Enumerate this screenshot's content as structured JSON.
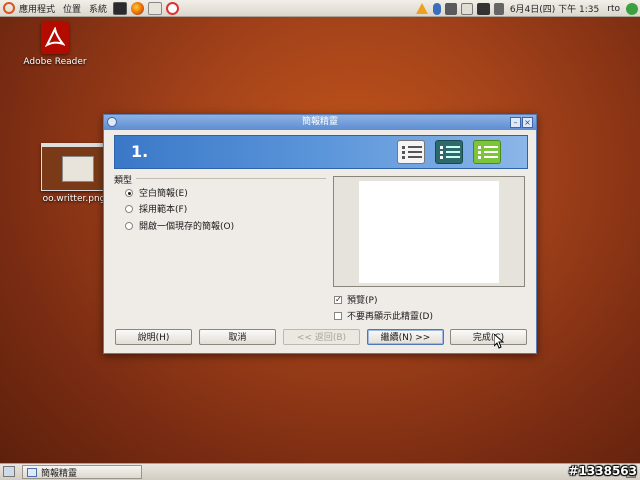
{
  "top_panel": {
    "menus": [
      "應用程式",
      "位置",
      "系統"
    ],
    "clock": "6月4日(四) 下午 1:35",
    "user": "rto"
  },
  "desktop": {
    "icons": [
      {
        "label": "Adobe Reader"
      },
      {
        "label": "oo.writter.png"
      }
    ]
  },
  "dialog": {
    "title": "簡報精靈",
    "step": "1.",
    "type_group_label": "類型",
    "options": [
      {
        "label": "空白簡報(E)",
        "selected": true
      },
      {
        "label": "採用範本(F)",
        "selected": false
      },
      {
        "label": "開啟一個現存的簡報(O)",
        "selected": false
      }
    ],
    "preview_label": "預覽(P)",
    "preview_checked": true,
    "no_show_label": "不要再顯示此精靈(D)",
    "no_show_checked": false,
    "buttons": {
      "help": "說明(H)",
      "cancel": "取消",
      "back": "<< 返回(B)",
      "next": "繼續(N) >>",
      "finish": "完成(C)"
    }
  },
  "taskbar": {
    "window_label": "簡報精靈"
  },
  "watermark": "#1338563",
  "colors": {
    "desktop": "#a3421a",
    "titlebar": "#5d8cd1",
    "banner": "#3a78c8"
  }
}
